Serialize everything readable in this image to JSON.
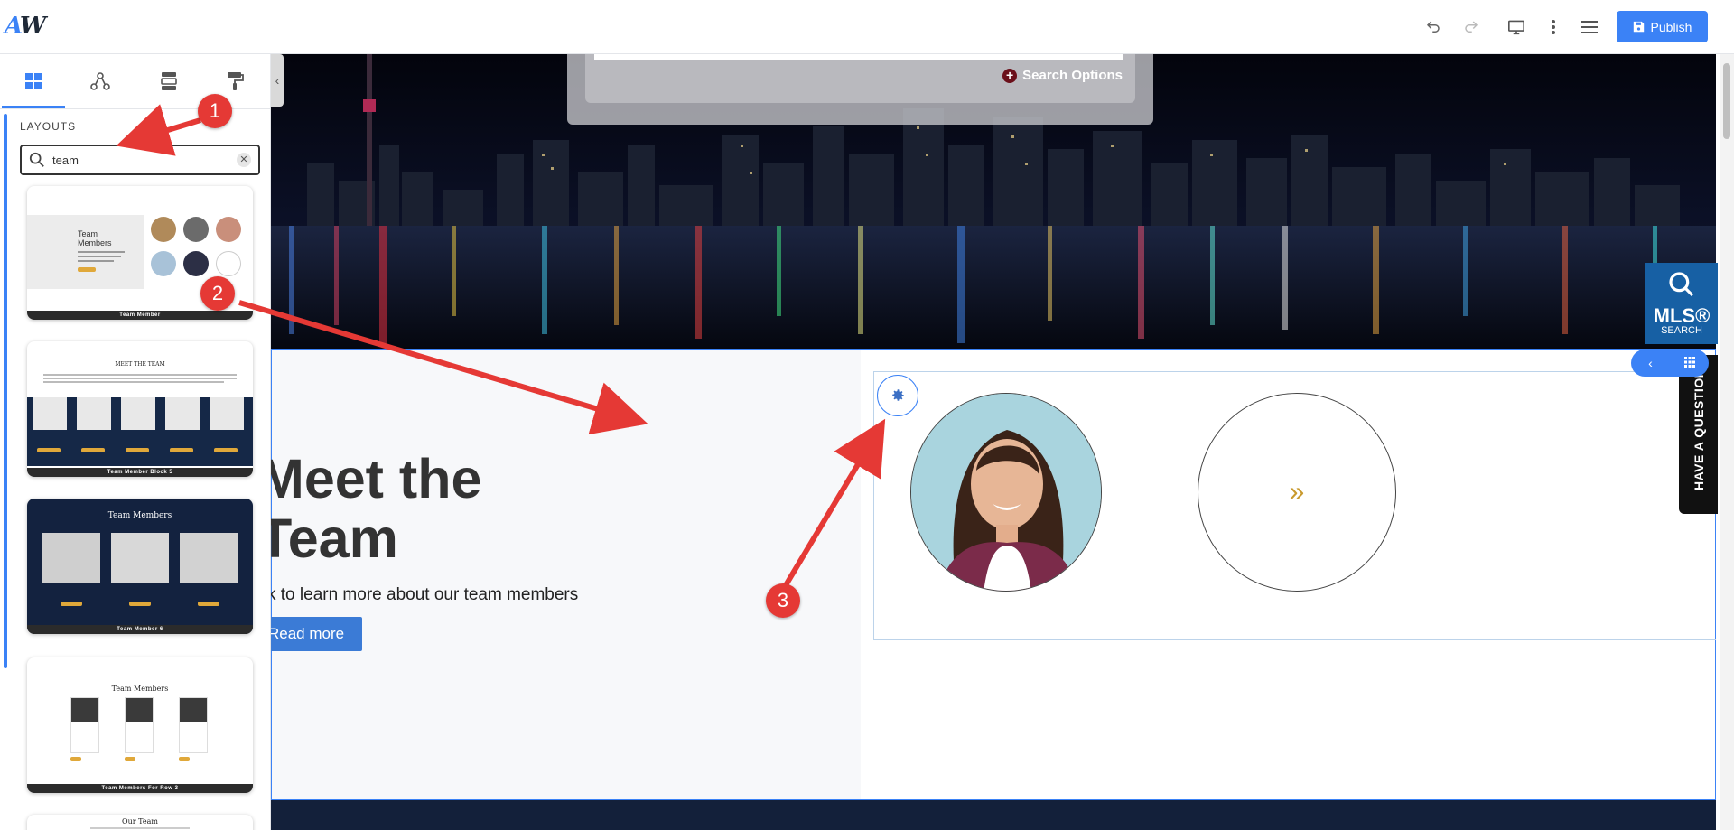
{
  "app": {
    "logo_a": "A",
    "logo_w": "W"
  },
  "toolbar": {
    "undo_icon": "undo-icon",
    "redo_icon": "redo-icon",
    "preview_icon": "monitor-icon",
    "more_icon": "kebab-icon",
    "menu_icon": "hamburger-icon",
    "publish_label": "Publish",
    "accent": "#3b82f6"
  },
  "panel": {
    "tabs": [
      {
        "name": "layouts",
        "icon": "grid-icon",
        "active": true
      },
      {
        "name": "components",
        "icon": "nodes-icon",
        "active": false
      },
      {
        "name": "sections",
        "icon": "blocks-icon",
        "active": false
      },
      {
        "name": "styles",
        "icon": "paint-roller-icon",
        "active": false
      }
    ],
    "section_label": "LAYOUTS",
    "search": {
      "value": "team",
      "placeholder": ""
    },
    "cards": [
      {
        "title": "Team Members",
        "caption": "Team Member"
      },
      {
        "title": "MEET THE TEAM",
        "caption": "Team Member Block 5"
      },
      {
        "title": "Team Members",
        "caption": "Team Member 6"
      },
      {
        "title": "Team Members",
        "caption": "Team Members For Row 3"
      },
      {
        "title": "Our Team",
        "caption": ""
      }
    ]
  },
  "canvas": {
    "search_options_label": "Search Options",
    "team": {
      "heading_line1": "Meet the",
      "heading_line2": "Team",
      "subtitle": "k to learn more about our team members",
      "button_label": "Read more",
      "next_glyph": "»"
    },
    "mls": {
      "big": "MLS®",
      "small": "SEARCH"
    },
    "question_tab": "HAVE A QUESTION?",
    "collapse_glyph": "‹"
  },
  "annotations": {
    "markers": [
      "1",
      "2",
      "3"
    ],
    "color": "#e53935"
  }
}
